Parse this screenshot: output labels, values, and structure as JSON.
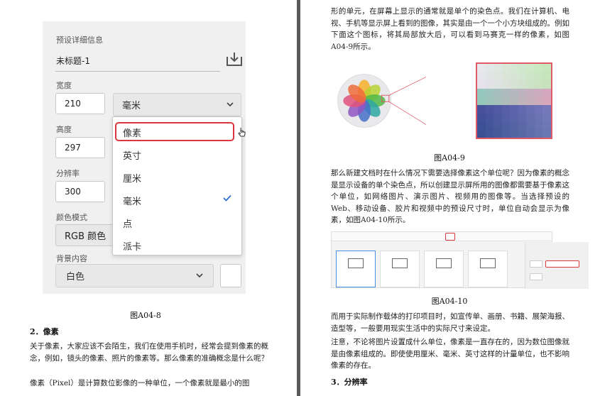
{
  "left_page": {
    "dialog": {
      "title": "预设详细信息",
      "doc_name": "未标题-1",
      "width_label": "宽度",
      "width_value": "210",
      "unit_value": "毫米",
      "height_label": "高度",
      "height_value": "297",
      "resolution_label": "分辨率",
      "resolution_value": "300",
      "color_mode_label": "颜色模式",
      "color_mode_value": "RGB 颜色",
      "background_label": "背景内容",
      "background_value": "白色",
      "unit_options": [
        "像素",
        "英寸",
        "厘米",
        "毫米",
        "点",
        "派卡"
      ]
    },
    "caption": "图A04-8",
    "section_heading": "2．像素",
    "paragraph1": "关于像素，大家应该不会陌生，我们在使用手机时，经常会提到像素的概念，例如，镜头的像素、照片的像素等。那么像素的准确概念是什么呢？",
    "paragraph2": "像素（Pixel）是计算数位影像的一种单位，一个像素就是最小的图"
  },
  "right_page": {
    "paragraph_top": "形的单元，在屏幕上显示的通常就是单个的染色点。我们在计算机、电视、手机等显示屏上看到的图像，其实是由一个一个小方块组成的。例如下面这个图标，将其局部放大后，可以看到马赛克一样的像素，如图A04-9所示。",
    "caption1": "图A04-9",
    "paragraph_mid": "那么新建文档时在什么情况下需要选择像素这个单位呢？因为像素的概念是显示设备的单个染色点，所以创建显示屏所用的图像都需要基于像素这个单位，如网络图片、演示图片、视频用的图像等。当选择预设的Web、移动设备、胶片和视频中的预设尺寸时，单位自动会显示为像素，如图A04-10所示。",
    "caption2": "图A04-10",
    "paragraph_3": "而用于实际制作载体的打印项目时，如宣传单、画册、书籍、展架海报、造型等，一般要用现实生活中的实际尺寸来设定。",
    "paragraph_4": "注意，不论将图片设置成什么单位，像素是一直存在的，因为数位图像就是由像素组成的。即使使用厘米、毫米、英寸这样的计量单位，也不影响像素的存在。",
    "section_heading": "3．分辨率"
  },
  "colors": {
    "highlight": "#d9363e",
    "check": "#2b6fd6",
    "zoom_frame": "#e05a6a"
  }
}
